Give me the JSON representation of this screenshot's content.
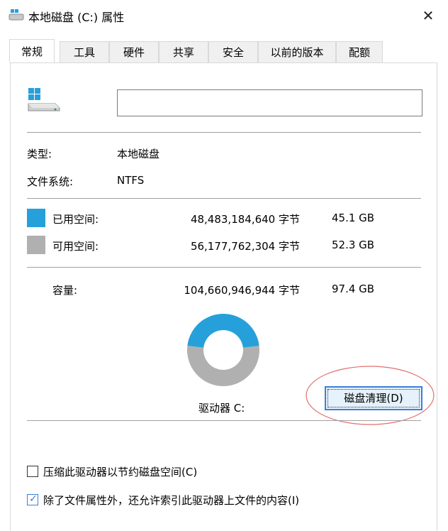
{
  "window": {
    "title": "本地磁盘 (C:) 属性",
    "close_glyph": "✕"
  },
  "tabs": [
    {
      "label": "常规",
      "active": true
    },
    {
      "label": "工具"
    },
    {
      "label": "硬件"
    },
    {
      "label": "共享"
    },
    {
      "label": "安全"
    },
    {
      "label": "以前的版本"
    },
    {
      "label": "配额"
    }
  ],
  "general": {
    "name_value": "",
    "type_label": "类型:",
    "type_value": "本地磁盘",
    "fs_label": "文件系统:",
    "fs_value": "NTFS",
    "used_label": "已用空间:",
    "used_bytes": "48,483,184,640 字节",
    "used_size": "45.1 GB",
    "free_label": "可用空间:",
    "free_bytes": "56,177,762,304 字节",
    "free_size": "52.3 GB",
    "capacity_label": "容量:",
    "capacity_bytes": "104,660,946,944 字节",
    "capacity_size": "97.4 GB",
    "drive_label": "驱动器 C:",
    "cleanup_button": "磁盘清理(D)",
    "compress_label": "压缩此驱动器以节约磁盘空间(C)",
    "compress_checked": false,
    "index_label": "除了文件属性外，还允许索引此驱动器上文件的内容(I)",
    "index_checked": true
  },
  "colors": {
    "used": "#26a0da",
    "free": "#b0b0b0",
    "highlight_ellipse": "#e07070"
  },
  "chart_data": {
    "type": "pie",
    "categories": [
      "已用空间",
      "可用空间"
    ],
    "values": [
      45.1,
      52.3
    ]
  }
}
